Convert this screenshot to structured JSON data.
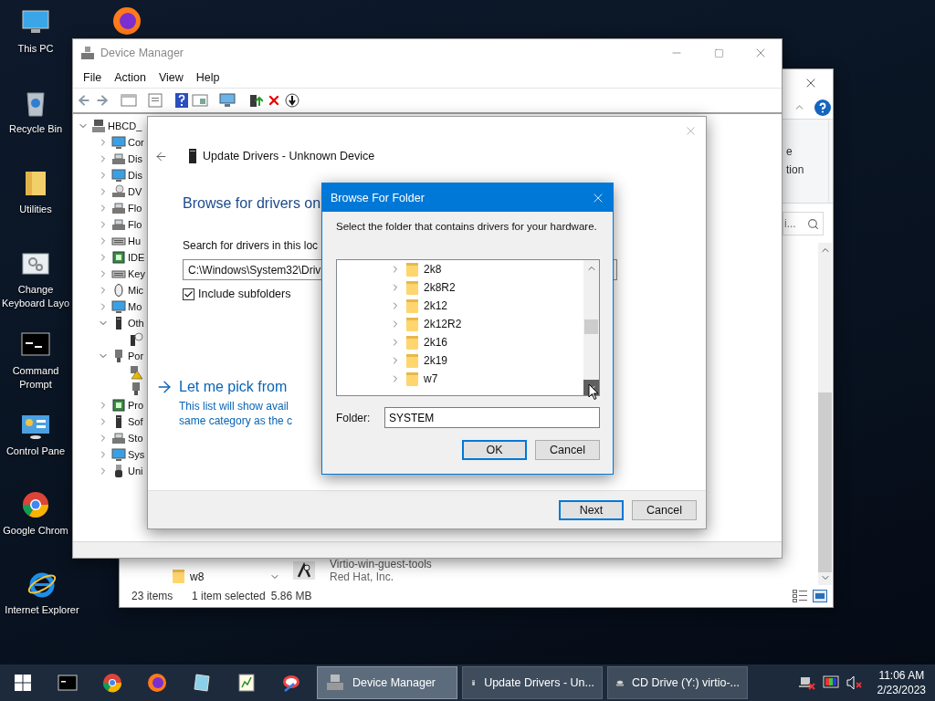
{
  "desktop_icons": [
    {
      "label": "This PC"
    },
    {
      "label": "Recycle Bin"
    },
    {
      "label": "Utilities"
    },
    {
      "label": "Change Keyboard Layo"
    },
    {
      "label": "Command Prompt"
    },
    {
      "label": "Control Pane"
    },
    {
      "label": "Google Chrom"
    },
    {
      "label": "Internet Explorer"
    }
  ],
  "explorer_window": {
    "ribbon_texts": [
      "e",
      "tion"
    ],
    "search": {
      "placeholder": "i..."
    },
    "nav_item": {
      "name": "w8"
    },
    "file": {
      "name": "Virtio-win-guest-tools",
      "publisher": "Red Hat, Inc."
    },
    "status_bar": {
      "items": "23 items",
      "selection": "1 item selected",
      "size": "5.86 MB"
    }
  },
  "device_manager": {
    "title": "Device Manager",
    "menu": [
      "File",
      "Action",
      "View",
      "Help"
    ],
    "tree": {
      "label": "HBCD_",
      "expanded": true,
      "children": [
        {
          "label": "Cor",
          "expanded": false
        },
        {
          "label": "Dis",
          "expanded": false
        },
        {
          "label": "Dis",
          "expanded": false
        },
        {
          "label": "DV",
          "expanded": false
        },
        {
          "label": "Flo",
          "expanded": false
        },
        {
          "label": "Flo",
          "expanded": false
        },
        {
          "label": "Hu",
          "expanded": false
        },
        {
          "label": "IDE",
          "expanded": false
        },
        {
          "label": "Key",
          "expanded": false
        },
        {
          "label": "Mic",
          "expanded": false
        },
        {
          "label": "Mo",
          "expanded": false
        },
        {
          "label": "Oth",
          "expanded": true,
          "children": [
            {
              "kind": "unknown"
            }
          ]
        },
        {
          "label": "Por",
          "expanded": true,
          "children": [
            {
              "kind": "warning"
            },
            {
              "kind": "port"
            }
          ]
        },
        {
          "label": "Pro",
          "expanded": false
        },
        {
          "label": "Sof",
          "expanded": false
        },
        {
          "label": "Sto",
          "expanded": false
        },
        {
          "label": "Sys",
          "expanded": false
        },
        {
          "label": "Uni",
          "expanded": false
        }
      ]
    }
  },
  "update_drivers": {
    "title": "Update Drivers - Unknown Device",
    "heading": "Browse for drivers on",
    "search_label": "Search for drivers in this loc",
    "path": "C:\\Windows\\System32\\Driv",
    "include_subfolders": {
      "label": "Include subfolders",
      "checked": true
    },
    "pick_link": "Let me pick from",
    "pick_description": [
      "This list will show avail",
      "same category as the c"
    ],
    "buttons": [
      "Next",
      "Cancel"
    ]
  },
  "browse_dialog": {
    "title": "Browse For Folder",
    "instruction": "Select the folder that contains drivers for your hardware.",
    "folders": [
      {
        "name": "2k8",
        "expanded": false
      },
      {
        "name": "2k8R2",
        "expanded": false
      },
      {
        "name": "2k12",
        "expanded": false
      },
      {
        "name": "2k12R2",
        "expanded": false
      },
      {
        "name": "2k16",
        "expanded": false
      },
      {
        "name": "2k19",
        "expanded": false
      },
      {
        "name": "w7",
        "expanded": false
      }
    ],
    "folder_label": "Folder:",
    "folder_value": "SYSTEM",
    "buttons": [
      {
        "label": "OK",
        "default": true
      },
      {
        "label": "Cancel",
        "default": false
      }
    ]
  },
  "taskbar": {
    "windows": [
      {
        "label": "Device Manager",
        "selected": true
      },
      {
        "label": "Update Drivers - Un...",
        "selected": false
      },
      {
        "label": "CD Drive (Y:) virtio-...",
        "selected": false
      }
    ],
    "time": "11:06 AM",
    "date": "2/23/2023"
  }
}
